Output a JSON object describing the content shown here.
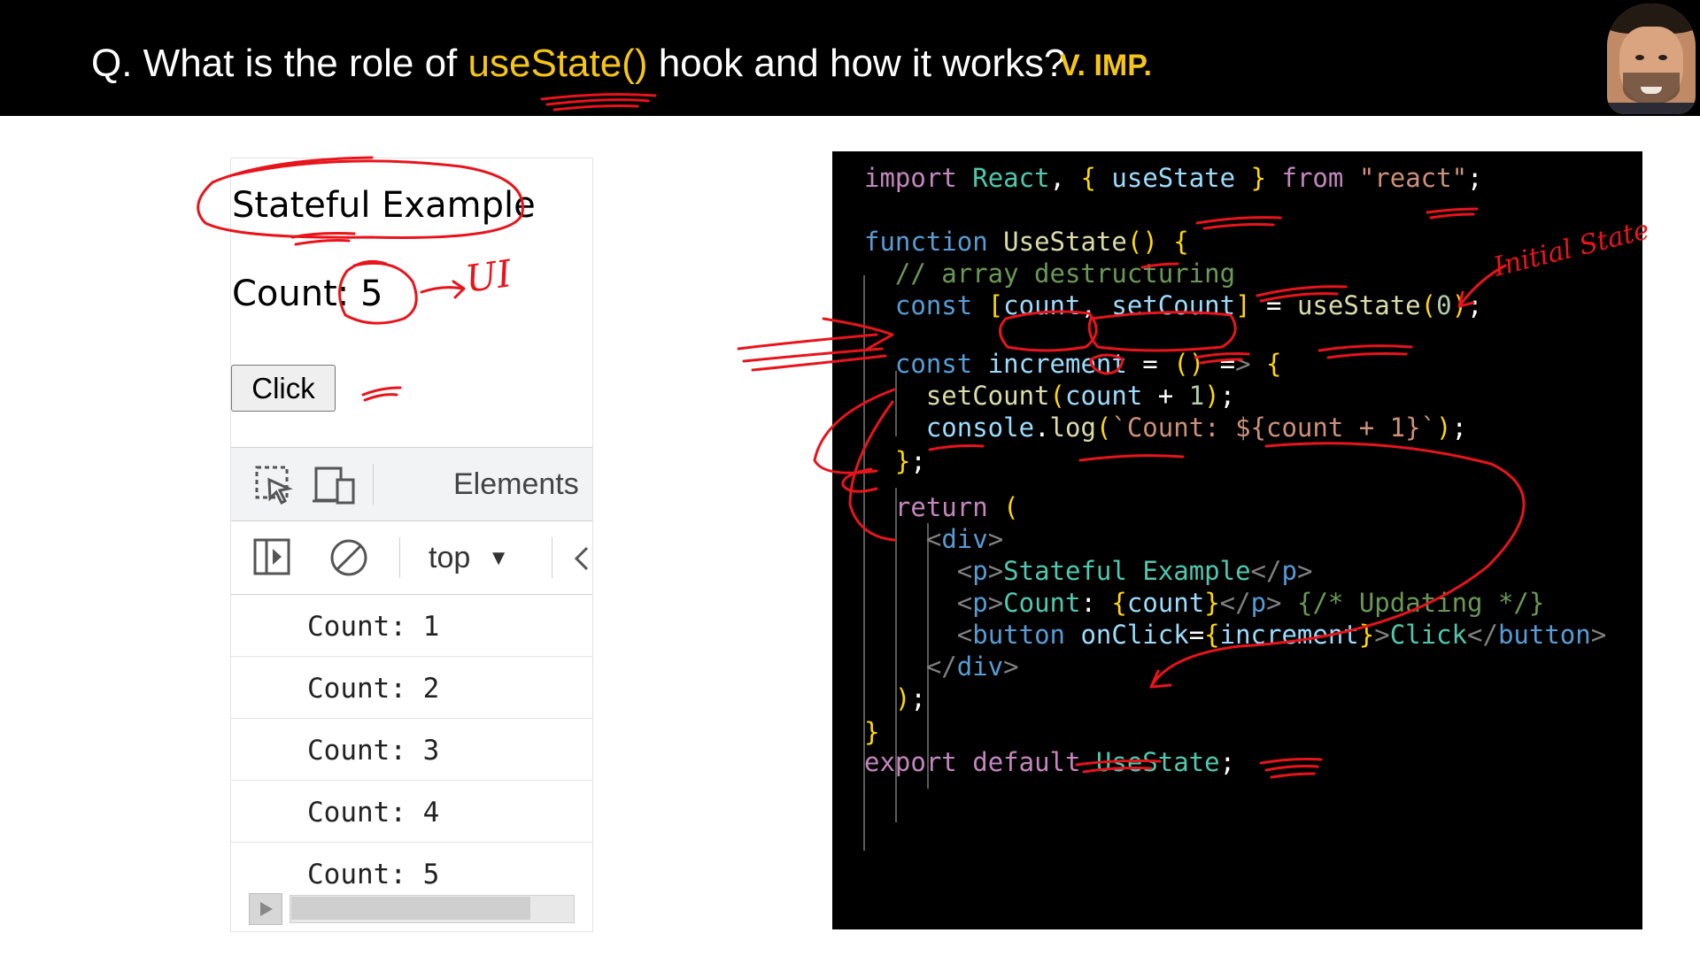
{
  "header": {
    "question_prefix": "Q. What is the role of ",
    "question_highlight": "useState()",
    "question_suffix": " hook and how it works?",
    "badge": "V. IMP."
  },
  "browser": {
    "heading": "Stateful Example",
    "count_text": "Count: 5",
    "button_label": "Click",
    "devtools": {
      "elements_tab": "Elements",
      "context": "top",
      "console_logs": [
        "Count: 1",
        "Count: 2",
        "Count: 3",
        "Count: 4",
        "Count: 5"
      ]
    }
  },
  "code": {
    "lines": [
      "import React, { useState } from \"react\";",
      "",
      "function UseState() {",
      "  // array destructuring",
      "  const [count, setCount] = useState(0);",
      "",
      "  const increment = () => {",
      "    setCount(count + 1);",
      "    console.log(`Count: ${count + 1}`);",
      "  };",
      "",
      "  return (",
      "    <div>",
      "      <p>Stateful Example</p>",
      "      <p>Count: {count}</p> {/* Updating */}",
      "      <button onClick={increment}>Click</button>",
      "    </div>",
      "  );",
      "}",
      "export default UseState;"
    ]
  },
  "annotations": {
    "ui_label": "UI",
    "initial_state_label": "Initial State"
  },
  "colors": {
    "header_bg": "#000000",
    "highlight": "#f5c518",
    "code_bg": "#000000",
    "annotation": "#e8141c"
  }
}
